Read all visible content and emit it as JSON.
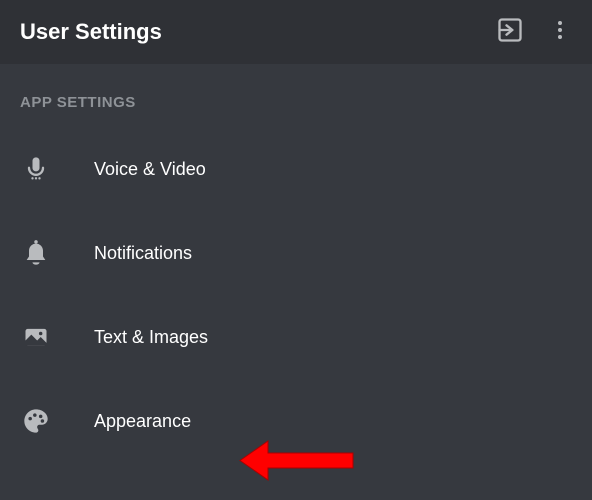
{
  "header": {
    "title": "User Settings"
  },
  "section": {
    "label": "APP SETTINGS"
  },
  "items": [
    {
      "label": "Voice & Video",
      "icon": "microphone-icon"
    },
    {
      "label": "Notifications",
      "icon": "bell-icon"
    },
    {
      "label": "Text & Images",
      "icon": "image-icon"
    },
    {
      "label": "Appearance",
      "icon": "palette-icon"
    }
  ],
  "colors": {
    "headerBg": "#2f3136",
    "bodyBg": "#36393f",
    "textPrimary": "#ffffff",
    "textSecondary": "#8e9297",
    "iconColor": "#b9bbbe",
    "arrowColor": "#ff0000"
  }
}
